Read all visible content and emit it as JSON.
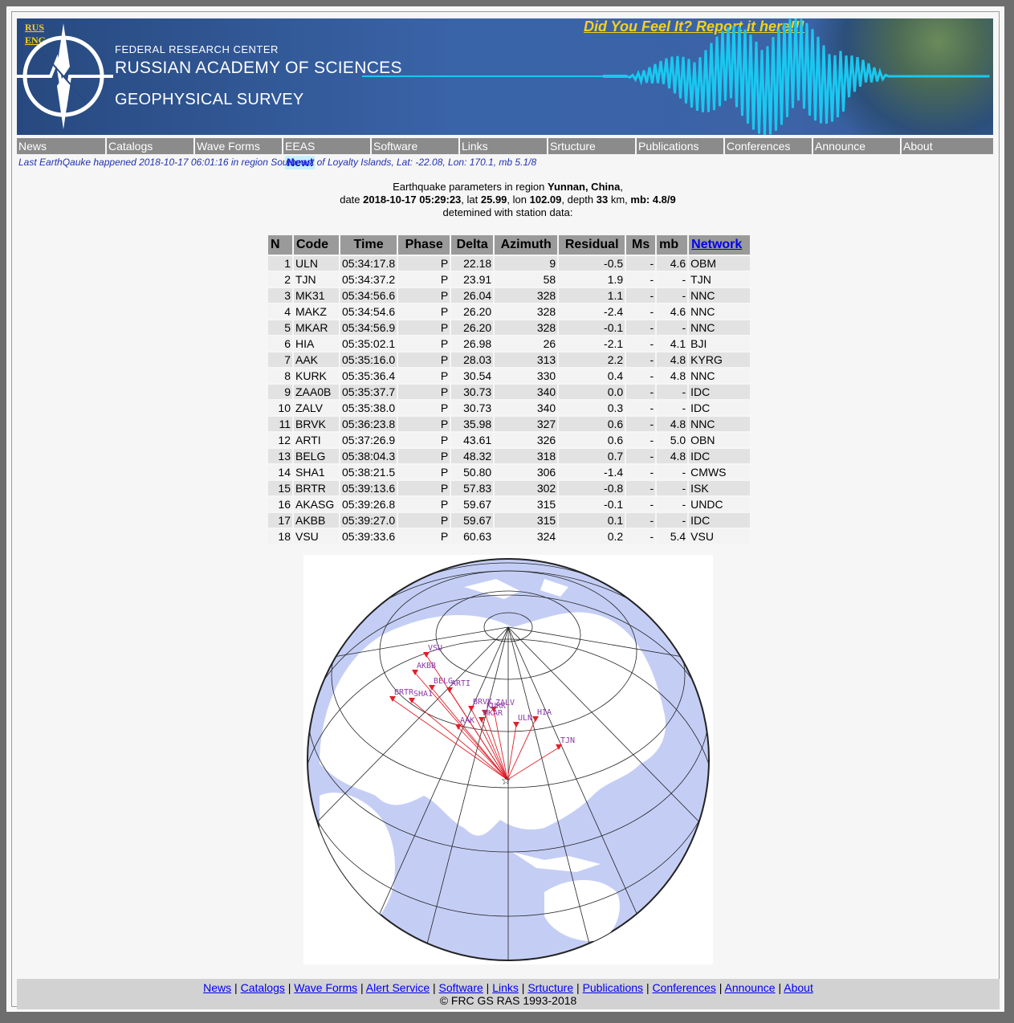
{
  "header": {
    "lang_rus": "RUS",
    "lang_eng": "ENG",
    "org_line1": "FEDERAL RESEARCH CENTER",
    "org_line2": "RUSSIAN ACADEMY OF SCIENCES",
    "org_line3": "GEOPHYSICAL SURVEY",
    "report_link": "Did You Feel It? Report it here!!!"
  },
  "nav": {
    "items": [
      "News",
      "Catalogs",
      "Wave Forms",
      "EEAS",
      "Software",
      "Links",
      "Srtucture",
      "Publications",
      "Conferences",
      "Announce",
      "About"
    ],
    "new_badge": "New!"
  },
  "last_quake": "Last EarthQauke happened 2018-10-17 06:01:16 in region Southeast of Loyalty Islands, Lat: -22.08, Lon: 170.1, mb 5.1/8",
  "params": {
    "line1_prefix": "Earthquake parameters in region ",
    "region": "Yunnan, China",
    "line1_suffix": ",",
    "date_label": "date ",
    "date": "2018-10-17 05:29:23",
    "lat_label": ", lat ",
    "lat": "25.99",
    "lon_label": ", lon ",
    "lon": "102.09",
    "depth_label": ", depth ",
    "depth": "33",
    "depth_unit": " km, ",
    "mb_label": "mb: ",
    "mb": "4.8/9",
    "line3": "detemined with station data:"
  },
  "table": {
    "headers": [
      "N",
      "Code",
      "Time",
      "Phase",
      "Delta",
      "Azimuth",
      "Residual",
      "Ms",
      "mb",
      "Network"
    ],
    "rows": [
      [
        "1",
        "ULN",
        "05:34:17.8",
        "P",
        "22.18",
        "9",
        "-0.5",
        "-",
        "4.6",
        "OBM"
      ],
      [
        "2",
        "TJN",
        "05:34:37.2",
        "P",
        "23.91",
        "58",
        "1.9",
        "-",
        "-",
        "TJN"
      ],
      [
        "3",
        "MK31",
        "05:34:56.6",
        "P",
        "26.04",
        "328",
        "1.1",
        "-",
        "-",
        "NNC"
      ],
      [
        "4",
        "MAKZ",
        "05:34:54.6",
        "P",
        "26.20",
        "328",
        "-2.4",
        "-",
        "4.6",
        "NNC"
      ],
      [
        "5",
        "MKAR",
        "05:34:56.9",
        "P",
        "26.20",
        "328",
        "-0.1",
        "-",
        "-",
        "NNC"
      ],
      [
        "6",
        "HIA",
        "05:35:02.1",
        "P",
        "26.98",
        "26",
        "-2.1",
        "-",
        "4.1",
        "BJI"
      ],
      [
        "7",
        "AAK",
        "05:35:16.0",
        "P",
        "28.03",
        "313",
        "2.2",
        "-",
        "4.8",
        "KYRG"
      ],
      [
        "8",
        "KURK",
        "05:35:36.4",
        "P",
        "30.54",
        "330",
        "0.4",
        "-",
        "4.8",
        "NNC"
      ],
      [
        "9",
        "ZAA0B",
        "05:35:37.7",
        "P",
        "30.73",
        "340",
        "0.0",
        "-",
        "-",
        "IDC"
      ],
      [
        "10",
        "ZALV",
        "05:35:38.0",
        "P",
        "30.73",
        "340",
        "0.3",
        "-",
        "-",
        "IDC"
      ],
      [
        "11",
        "BRVK",
        "05:36:23.8",
        "P",
        "35.98",
        "327",
        "0.6",
        "-",
        "4.8",
        "NNC"
      ],
      [
        "12",
        "ARTI",
        "05:37:26.9",
        "P",
        "43.61",
        "326",
        "0.6",
        "-",
        "5.0",
        "OBN"
      ],
      [
        "13",
        "BELG",
        "05:38:04.3",
        "P",
        "48.32",
        "318",
        "0.7",
        "-",
        "4.8",
        "IDC"
      ],
      [
        "14",
        "SHA1",
        "05:38:21.5",
        "P",
        "50.80",
        "306",
        "-1.4",
        "-",
        "-",
        "CMWS"
      ],
      [
        "15",
        "BRTR",
        "05:39:13.6",
        "P",
        "57.83",
        "302",
        "-0.8",
        "-",
        "-",
        "ISK"
      ],
      [
        "16",
        "AKASG",
        "05:39:26.8",
        "P",
        "59.67",
        "315",
        "-0.1",
        "-",
        "-",
        "UNDC"
      ],
      [
        "17",
        "AKBB",
        "05:39:27.0",
        "P",
        "59.67",
        "315",
        "0.1",
        "-",
        "-",
        "IDC"
      ],
      [
        "18",
        "VSU",
        "05:39:33.6",
        "P",
        "60.63",
        "324",
        "0.2",
        "-",
        "5.4",
        "VSU"
      ]
    ]
  },
  "map": {
    "epicenter_marker": "☆",
    "station_labels": [
      "VSU",
      "AKBB",
      "BELG",
      "ARTI",
      "BRTR",
      "SHA1",
      "BRVK",
      "ZALV",
      "KURK",
      "MKAR",
      "ULN",
      "HIA",
      "TJN",
      "AAK"
    ]
  },
  "footer": {
    "links": [
      "News",
      "Catalogs",
      "Wave Forms",
      "Alert Service",
      "Software",
      "Links",
      "Srtucture",
      "Publications",
      "Conferences",
      "Announce",
      "About"
    ],
    "separator": " | ",
    "copyright": "© FRC GS RAS 1993-2018"
  },
  "colors": {
    "banner": "#3a64a8",
    "nav": "#8b8b8b",
    "accent_yellow": "#f3d21a",
    "link": "#0000ee",
    "seismo": "#19c8f0",
    "station": "#e0202a"
  }
}
